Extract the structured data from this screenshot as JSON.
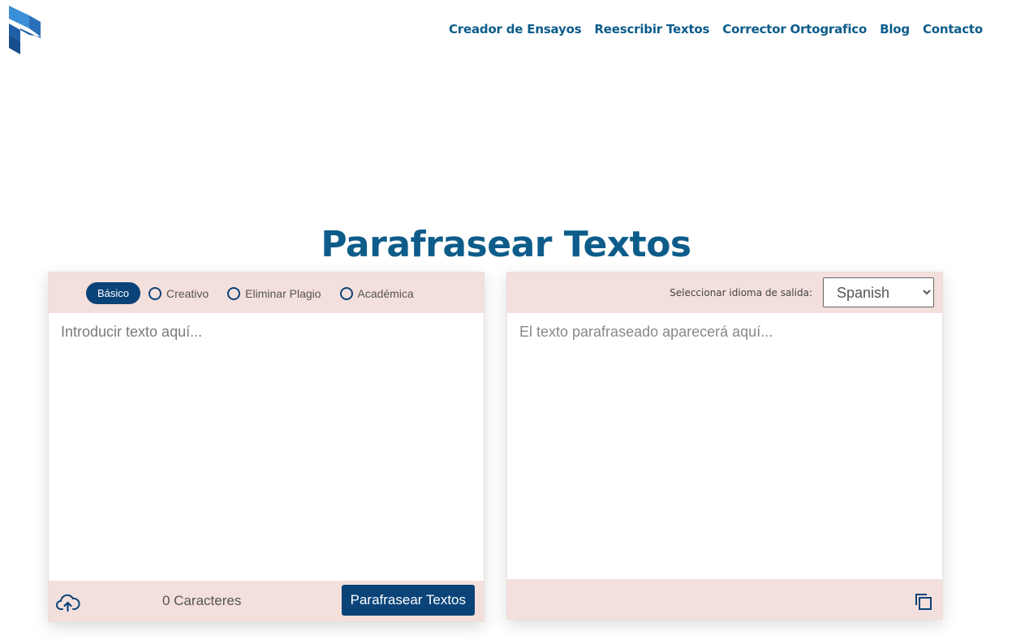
{
  "nav": {
    "items": [
      "Creador de Ensayos",
      "Reescribir Textos",
      "Corrector Ortografico",
      "Blog",
      "Contacto"
    ]
  },
  "page": {
    "title": "Parafrasear Textos"
  },
  "input_panel": {
    "modes": {
      "active": "Básico",
      "others": [
        "Creativo",
        "Eliminar Plagio",
        "Académica"
      ]
    },
    "placeholder": "Introducir texto aquí...",
    "char_count": "0 Caracteres",
    "submit_label": "Parafrasear Textos"
  },
  "output_panel": {
    "language_label": "Seleccionar idioma de salida:",
    "language_selected": "Spanish",
    "placeholder": "El texto parafraseado aparecerá aquí..."
  },
  "icons": {
    "logo": "brand-logo-icon",
    "upload": "cloud-upload-icon",
    "copy": "copy-icon"
  },
  "colors": {
    "brand_dark": "#0a4378",
    "brand_text": "#0d5c8a",
    "panel_band": "#f3dfdc",
    "logo_light": "#3a8fd6",
    "logo_dark": "#1f5fa8"
  }
}
